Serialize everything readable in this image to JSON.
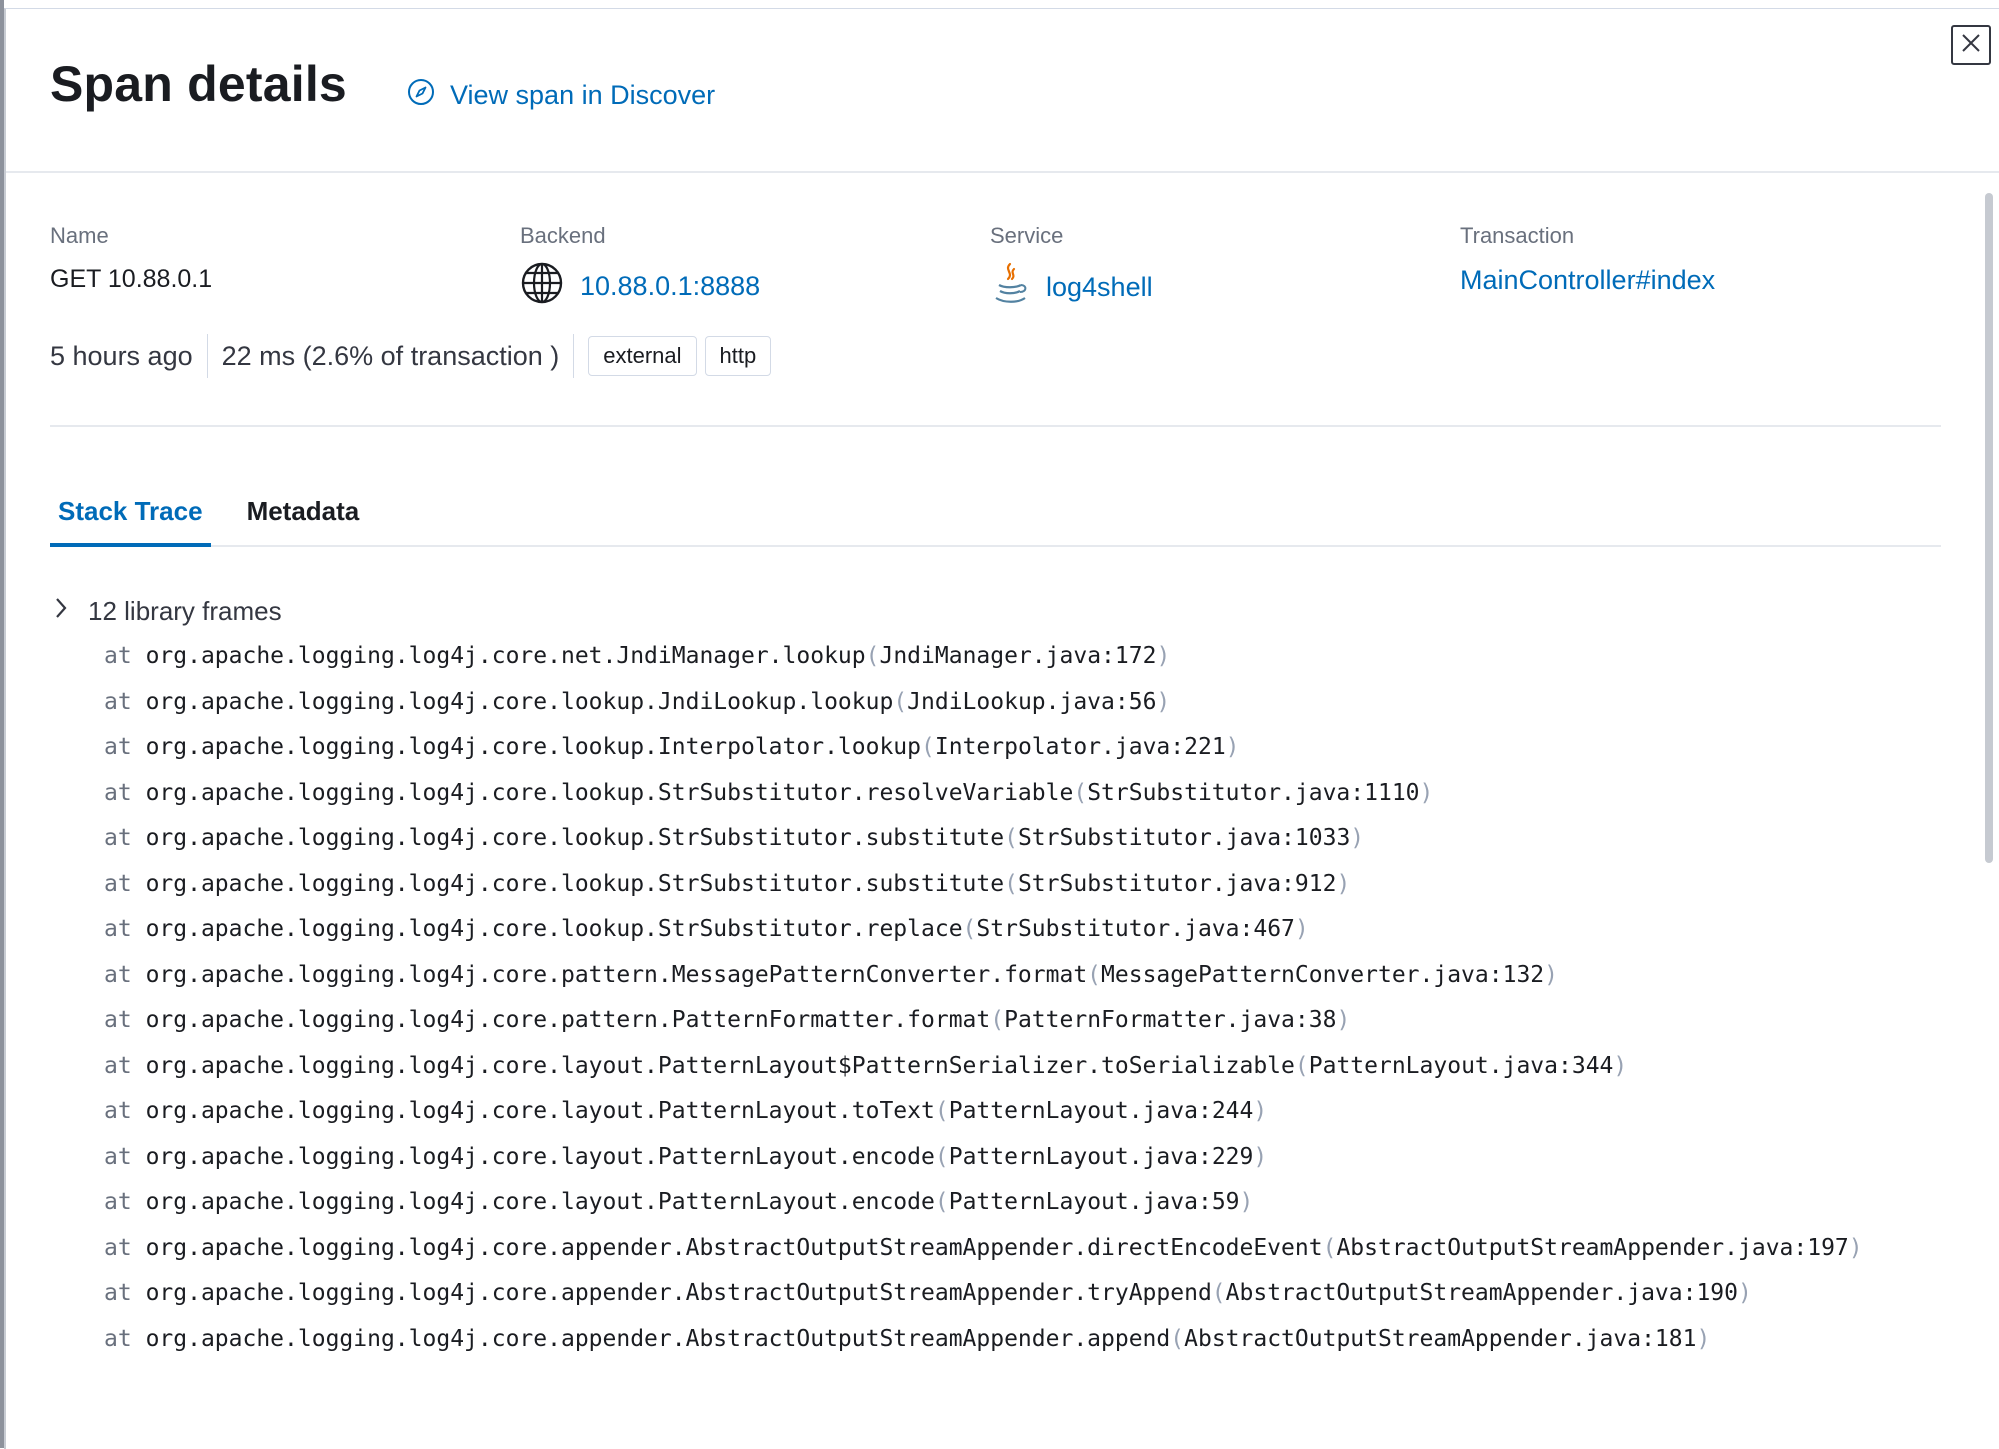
{
  "header": {
    "title": "Span details",
    "discover_link": "View span in Discover"
  },
  "summary": {
    "name_label": "Name",
    "name_value": "GET 10.88.0.1",
    "backend_label": "Backend",
    "backend_value": "10.88.0.1:8888",
    "service_label": "Service",
    "service_value": "log4shell",
    "transaction_label": "Transaction",
    "transaction_value": "MainController#index"
  },
  "meta": {
    "timestamp": "5 hours ago",
    "duration": "22 ms (2.6% of transaction )",
    "badges": [
      "external",
      "http"
    ]
  },
  "tabs": [
    "Stack Trace",
    "Metadata"
  ],
  "stack_trace": {
    "library_frames_label": "12 library frames",
    "at": "at",
    "frames": [
      {
        "fn": "org.apache.logging.log4j.core.net.JndiManager.lookup",
        "loc": "JndiManager.java:172"
      },
      {
        "fn": "org.apache.logging.log4j.core.lookup.JndiLookup.lookup",
        "loc": "JndiLookup.java:56"
      },
      {
        "fn": "org.apache.logging.log4j.core.lookup.Interpolator.lookup",
        "loc": "Interpolator.java:221"
      },
      {
        "fn": "org.apache.logging.log4j.core.lookup.StrSubstitutor.resolveVariable",
        "loc": "StrSubstitutor.java:1110"
      },
      {
        "fn": "org.apache.logging.log4j.core.lookup.StrSubstitutor.substitute",
        "loc": "StrSubstitutor.java:1033"
      },
      {
        "fn": "org.apache.logging.log4j.core.lookup.StrSubstitutor.substitute",
        "loc": "StrSubstitutor.java:912"
      },
      {
        "fn": "org.apache.logging.log4j.core.lookup.StrSubstitutor.replace",
        "loc": "StrSubstitutor.java:467"
      },
      {
        "fn": "org.apache.logging.log4j.core.pattern.MessagePatternConverter.format",
        "loc": "MessagePatternConverter.java:132"
      },
      {
        "fn": "org.apache.logging.log4j.core.pattern.PatternFormatter.format",
        "loc": "PatternFormatter.java:38"
      },
      {
        "fn": "org.apache.logging.log4j.core.layout.PatternLayout$PatternSerializer.toSerializable",
        "loc": "PatternLayout.java:344"
      },
      {
        "fn": "org.apache.logging.log4j.core.layout.PatternLayout.toText",
        "loc": "PatternLayout.java:244"
      },
      {
        "fn": "org.apache.logging.log4j.core.layout.PatternLayout.encode",
        "loc": "PatternLayout.java:229"
      },
      {
        "fn": "org.apache.logging.log4j.core.layout.PatternLayout.encode",
        "loc": "PatternLayout.java:59"
      },
      {
        "fn": "org.apache.logging.log4j.core.appender.AbstractOutputStreamAppender.directEncodeEvent",
        "loc": "AbstractOutputStreamAppender.java:197"
      },
      {
        "fn": "org.apache.logging.log4j.core.appender.AbstractOutputStreamAppender.tryAppend",
        "loc": "AbstractOutputStreamAppender.java:190"
      },
      {
        "fn": "org.apache.logging.log4j.core.appender.AbstractOutputStreamAppender.append",
        "loc": "AbstractOutputStreamAppender.java:181"
      }
    ]
  },
  "colors": {
    "link": "#006bb8",
    "text": "#1a1c21",
    "muted": "#69707d"
  },
  "icons": {
    "discover": "compass-icon",
    "backend": "globe-icon",
    "service": "java-icon",
    "close": "close-icon",
    "expand": "chevron-right-icon"
  }
}
